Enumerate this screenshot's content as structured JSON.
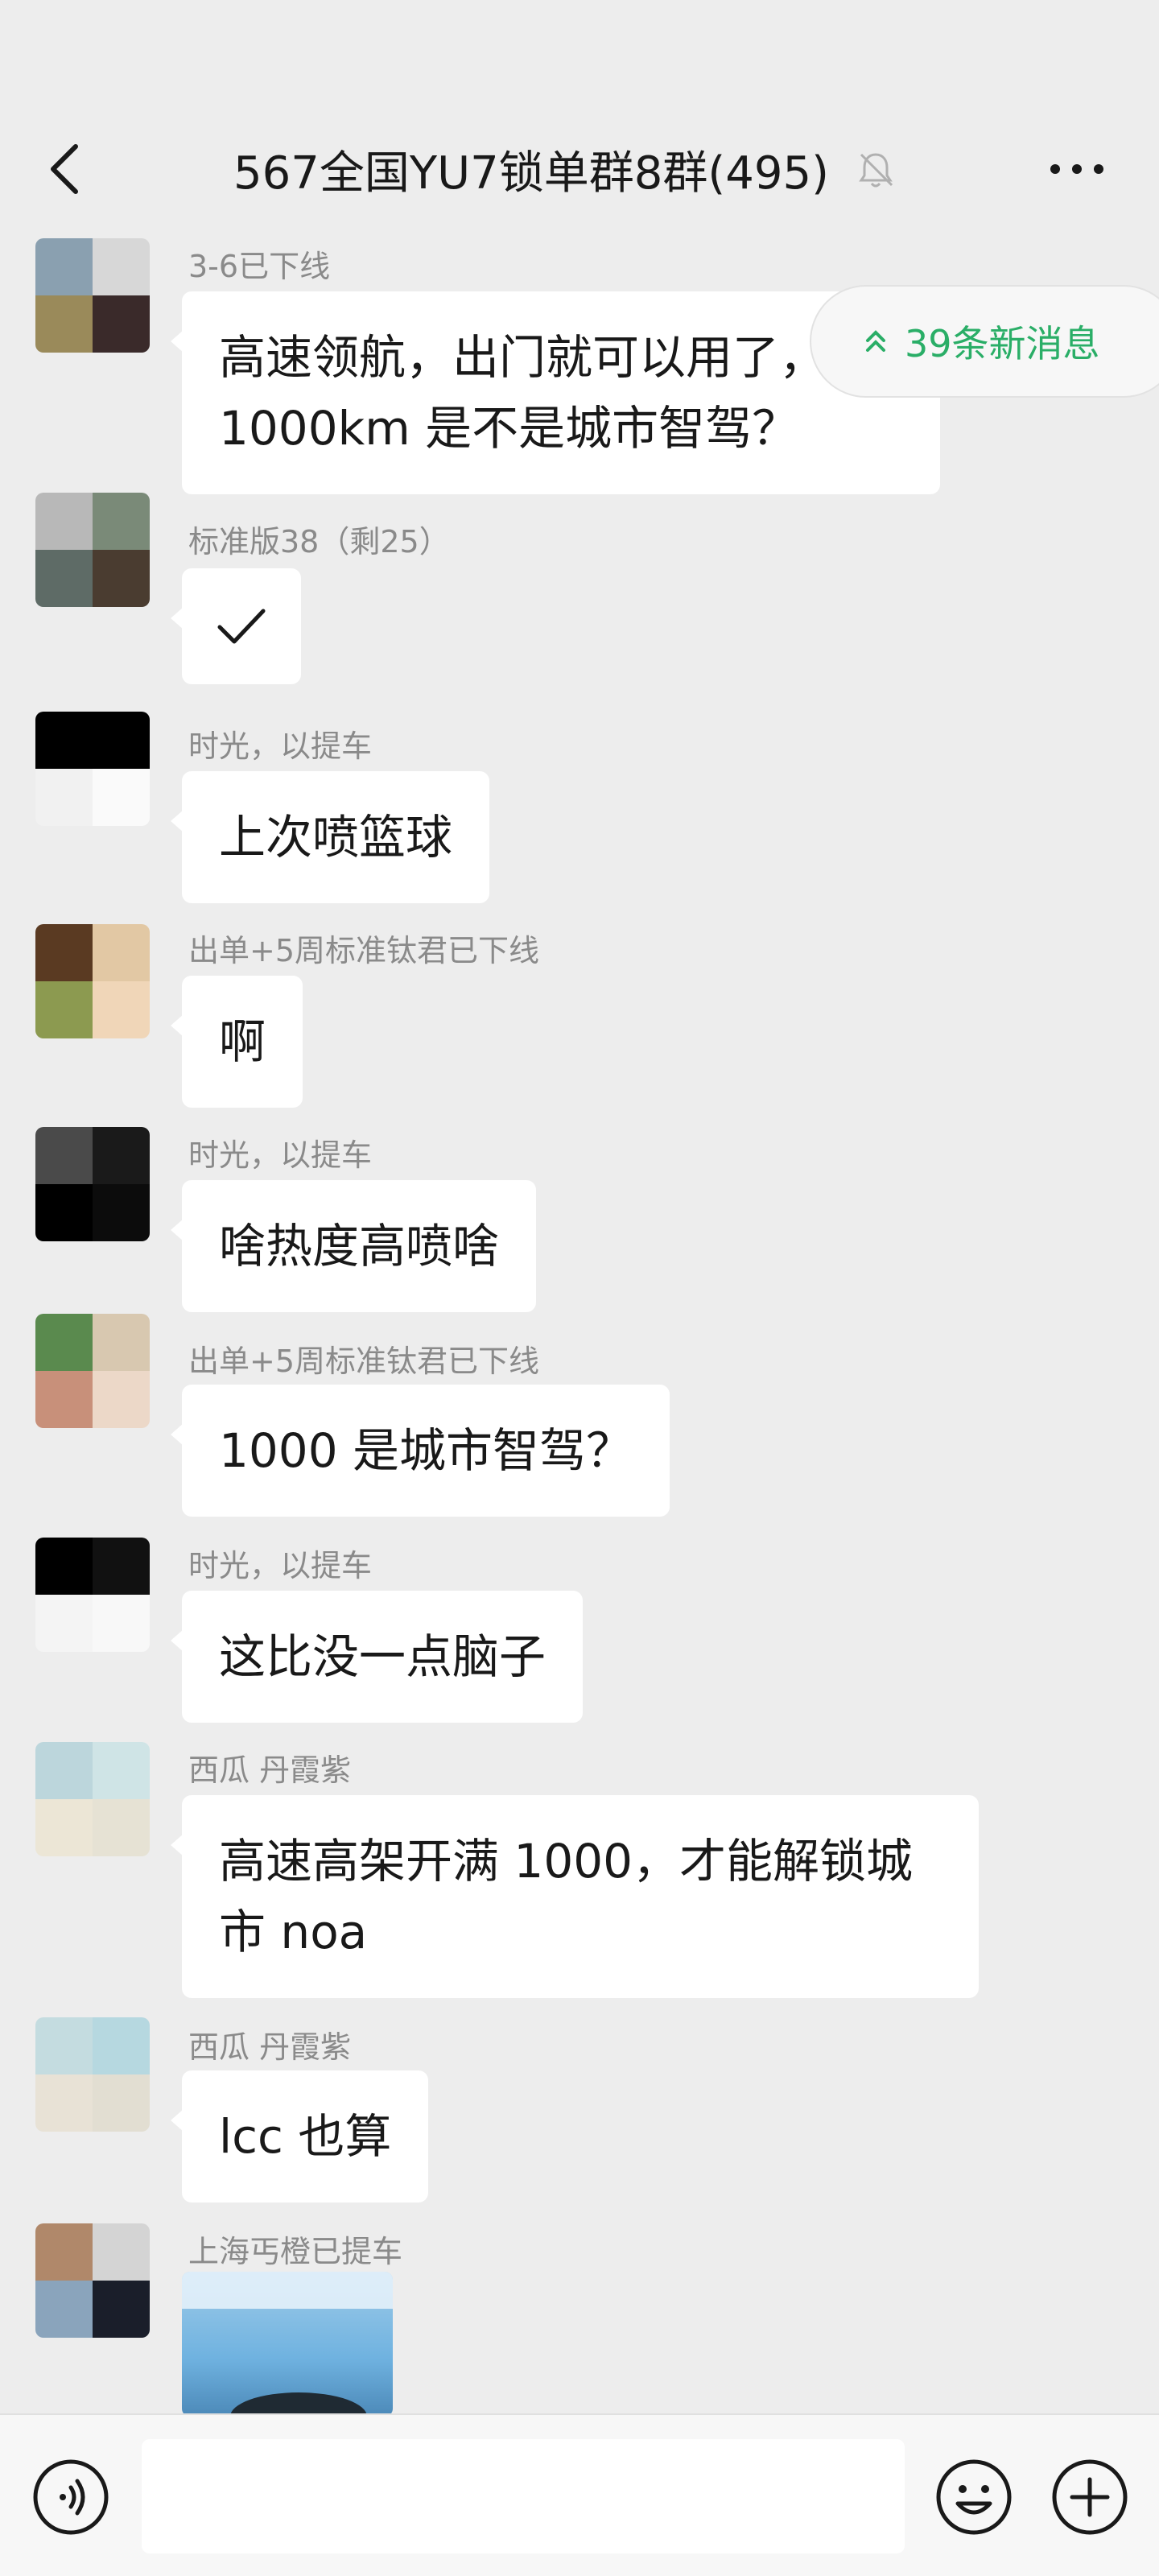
{
  "header": {
    "title": "567全国YU7锁单群8",
    "title_suffix": "群(495)",
    "back_icon": "chevron-left-icon",
    "mute_icon": "bell-off-icon",
    "more_icon": "more-dots-icon"
  },
  "new_messages": {
    "label": "39条新消息",
    "icon": "double-chevron-up-icon",
    "color": "#2aae67"
  },
  "messages": [
    {
      "sender": "3-6已下线",
      "text_lines": [
        "高速领航，出门就可以用了，",
        "1000km 是不是城市智驾？"
      ]
    },
    {
      "sender": "标准版38（剩25）",
      "text": "✓"
    },
    {
      "sender": "时光，以提车",
      "text": "上次喷篮球"
    },
    {
      "sender": "出单+5周标准钛君已下线",
      "text": "啊"
    },
    {
      "sender": "时光，以提车",
      "text": "啥热度高喷啥"
    },
    {
      "sender": "出单+5周标准钛君已下线",
      "text": "1000 是城市智驾？"
    },
    {
      "sender": "时光，以提车",
      "text": "这比没一点脑子"
    },
    {
      "sender": "西瓜 丹霞紫",
      "text_lines": [
        "高速高架开满 1000，才能解锁城",
        "市 noa"
      ]
    },
    {
      "sender": "西瓜 丹霞紫",
      "text": "lcc 也算"
    },
    {
      "sender": "上海丐橙已提车",
      "image": "photo-thumbnail"
    }
  ],
  "input_bar": {
    "voice_icon": "voice-icon",
    "emoji_icon": "emoji-icon",
    "plus_icon": "plus-circle-icon",
    "placeholder": ""
  }
}
